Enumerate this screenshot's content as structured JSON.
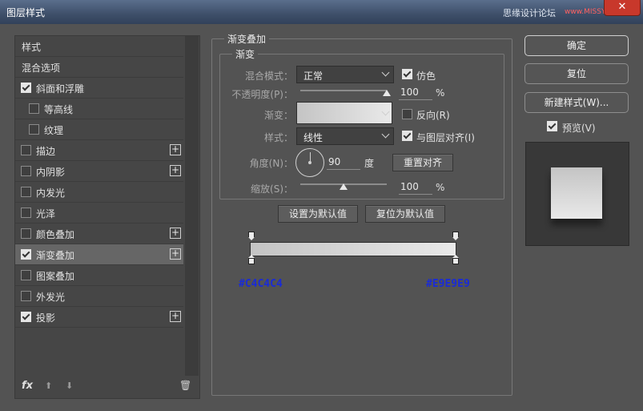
{
  "window": {
    "title": "图层样式",
    "watermark": "思缘设计论坛",
    "watermark_url": "www.MISSYUAN.COM",
    "close_label": "✕"
  },
  "sidebar": {
    "items": [
      {
        "label": "样式",
        "checkbox": false,
        "checked": false,
        "plus": false,
        "selected": false
      },
      {
        "label": "混合选项",
        "checkbox": false,
        "checked": false,
        "plus": false,
        "selected": false
      },
      {
        "label": "斜面和浮雕",
        "checkbox": true,
        "checked": true,
        "plus": false,
        "selected": false
      },
      {
        "label": "等高线",
        "checkbox": true,
        "checked": false,
        "plus": false,
        "selected": false,
        "indent": true
      },
      {
        "label": "纹理",
        "checkbox": true,
        "checked": false,
        "plus": false,
        "selected": false,
        "indent": true
      },
      {
        "label": "描边",
        "checkbox": true,
        "checked": false,
        "plus": true,
        "selected": false
      },
      {
        "label": "内阴影",
        "checkbox": true,
        "checked": false,
        "plus": true,
        "selected": false
      },
      {
        "label": "内发光",
        "checkbox": true,
        "checked": false,
        "plus": false,
        "selected": false
      },
      {
        "label": "光泽",
        "checkbox": true,
        "checked": false,
        "plus": false,
        "selected": false
      },
      {
        "label": "颜色叠加",
        "checkbox": true,
        "checked": false,
        "plus": true,
        "selected": false
      },
      {
        "label": "渐变叠加",
        "checkbox": true,
        "checked": true,
        "plus": true,
        "selected": true
      },
      {
        "label": "图案叠加",
        "checkbox": true,
        "checked": false,
        "plus": false,
        "selected": false
      },
      {
        "label": "外发光",
        "checkbox": true,
        "checked": false,
        "plus": false,
        "selected": false
      },
      {
        "label": "投影",
        "checkbox": true,
        "checked": true,
        "plus": true,
        "selected": false
      }
    ],
    "footer": {
      "fx": "fx",
      "up": "⬆",
      "down": "⬇",
      "trash": "🗑"
    }
  },
  "panel": {
    "section_title": "渐变叠加",
    "group_title": "渐变",
    "blend_mode_label": "混合模式：",
    "blend_mode_value": "正常",
    "dither_label": "仿色",
    "dither_checked": true,
    "opacity_label": "不透明度(P)：",
    "opacity_value": "100",
    "opacity_fraction": 1.0,
    "percent": "%",
    "gradient_label": "渐变：",
    "reverse_label": "反向(R)",
    "reverse_checked": false,
    "style_label": "样式：",
    "style_value": "线性",
    "align_label": "与图层对齐(I)",
    "align_checked": true,
    "angle_label": "角度(N)：",
    "angle_value": "90",
    "angle_unit": "度",
    "reset_align_label": "重置对齐",
    "scale_label": "缩放(S)：",
    "scale_value": "100",
    "scale_fraction": 0.5,
    "set_default_label": "设置为默认值",
    "reset_default_label": "复位为默认值"
  },
  "gradient_editor": {
    "start_color_hex": "#C4C4C4",
    "end_color_hex": "#E9E9E9"
  },
  "right": {
    "ok_label": "确定",
    "reset_label": "复位",
    "new_style_label": "新建样式(W)...",
    "preview_label": "预览(V)",
    "preview_checked": true
  },
  "colors": {
    "accent_hex_text": "#1A2BD6",
    "gradient_start": "#C4C4C4",
    "gradient_end": "#E9E9E9"
  }
}
